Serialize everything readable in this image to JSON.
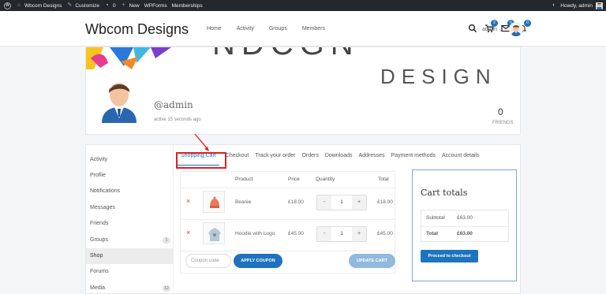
{
  "admin_bar": {
    "site_name": "Wbcom Designs",
    "customize": "Customize",
    "comments_count": "0",
    "new_label": "New",
    "wpforms": "WPForms",
    "memberships": "Memberships",
    "howdy": "Howdy, admin"
  },
  "header": {
    "site_title": "Wbcom Designs",
    "nav": [
      "Home",
      "Activity",
      "Groups",
      "Members"
    ],
    "cart_badge": "2",
    "messages_badge": "0",
    "notifications_badge": "0",
    "user_menu": "admin"
  },
  "profile": {
    "cover_text": "DESIGN",
    "username": "@admin",
    "activity": "active 15 seconds ago",
    "friends_count": "0",
    "friends_label": "FRIENDS"
  },
  "sidebar": {
    "items": [
      {
        "label": "Activity",
        "count": ""
      },
      {
        "label": "Profile",
        "count": ""
      },
      {
        "label": "Notifications",
        "count": ""
      },
      {
        "label": "Messages",
        "count": ""
      },
      {
        "label": "Friends",
        "count": ""
      },
      {
        "label": "Groups",
        "count": "1"
      },
      {
        "label": "Shop",
        "count": ""
      },
      {
        "label": "Forums",
        "count": ""
      },
      {
        "label": "Media",
        "count": "12"
      }
    ],
    "active": "Shop"
  },
  "tabs": [
    "Shopping Cart",
    "Checkout",
    "Track your order",
    "Orders",
    "Downloads",
    "Addresses",
    "Payment methods",
    "Account details"
  ],
  "cart": {
    "headers": {
      "product": "Product",
      "price": "Price",
      "quantity": "Quantity",
      "total": "Total"
    },
    "rows": [
      {
        "name": "Beanie",
        "price": "£18.00",
        "qty": "1",
        "total": "£18.00",
        "thumb_icon": "beanie-icon"
      },
      {
        "name": "Hoodie with Logo",
        "price": "£45.00",
        "qty": "1",
        "total": "£45.00",
        "thumb_icon": "hoodie-icon"
      }
    ],
    "remove_symbol": "×",
    "minus": "-",
    "plus": "+",
    "coupon_placeholder": "Coupon code",
    "apply_coupon": "APPLY COUPON",
    "update_cart": "UPDATE CART"
  },
  "totals": {
    "title": "Cart totals",
    "subtotal_label": "Subtotal",
    "subtotal_value": "£63.00",
    "total_label": "Total",
    "total_value": "£63.00",
    "checkout_button": "Proceed to checkout"
  },
  "colors": {
    "accent": "#1e73be",
    "highlight": "#e02020",
    "admin_bar": "#23282d"
  }
}
